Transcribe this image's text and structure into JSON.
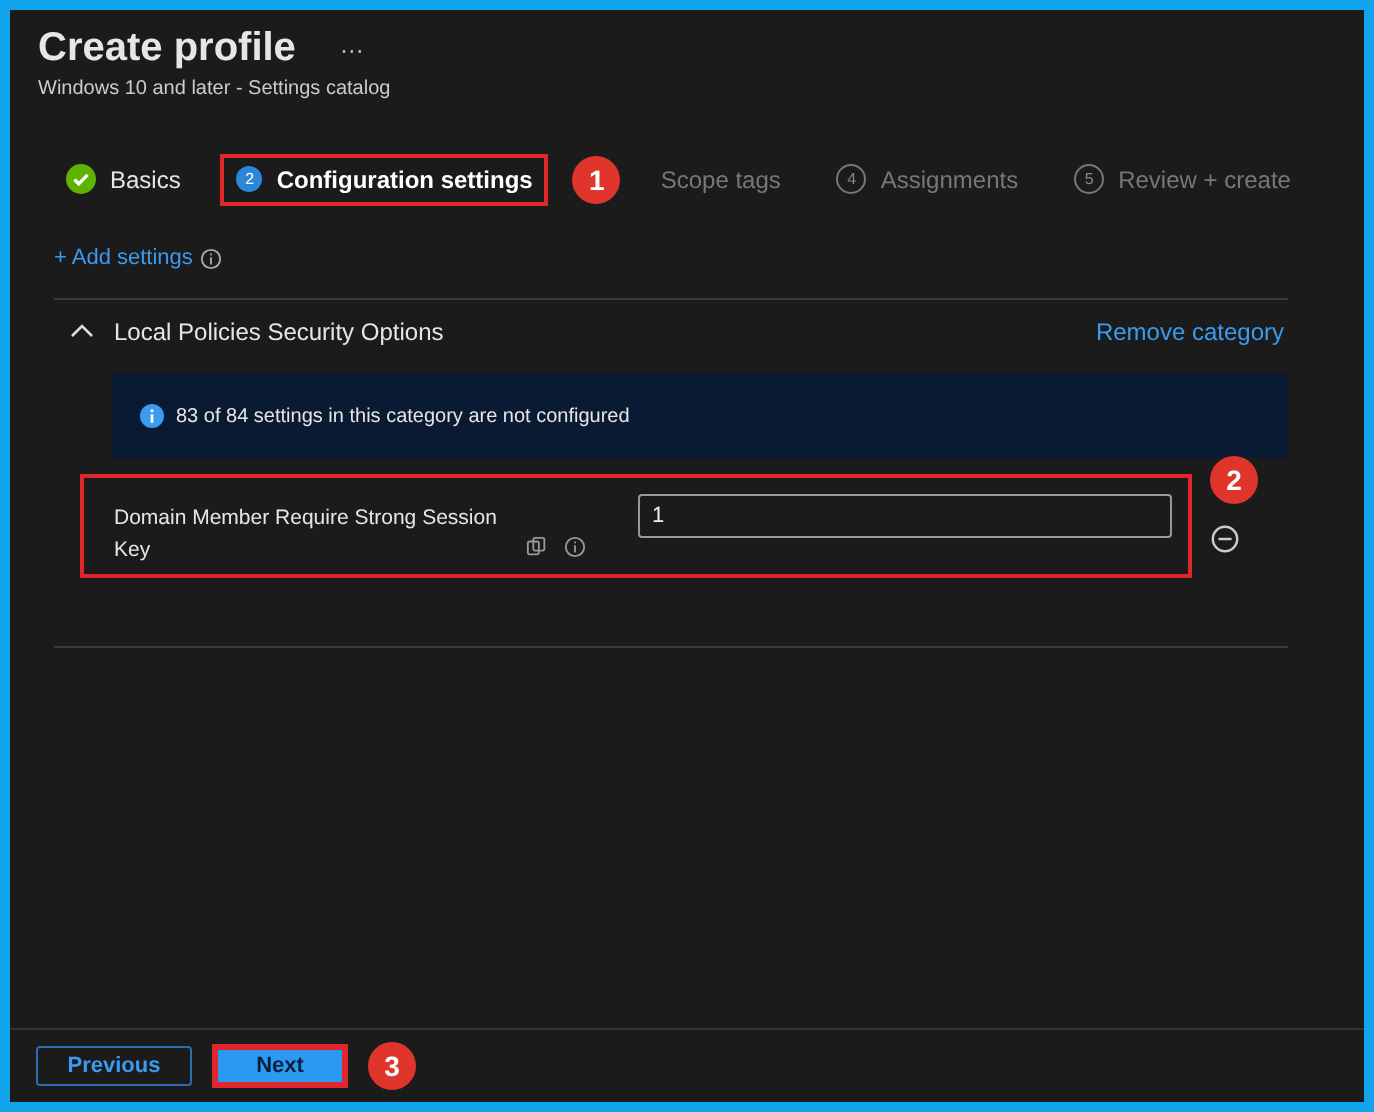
{
  "header": {
    "title": "Create profile",
    "more": "···",
    "subtitle": "Windows 10 and later - Settings catalog"
  },
  "steps": [
    {
      "kind": "done",
      "label": "Basics",
      "selected": false,
      "highlighted": false
    },
    {
      "kind": "current",
      "number": "2",
      "label": "Configuration settings",
      "selected": true,
      "highlighted": true,
      "callout": "1"
    },
    {
      "kind": "pending",
      "label": "Scope tags",
      "selected": false,
      "highlighted": false
    },
    {
      "kind": "pending",
      "number": "4",
      "label": "Assignments",
      "selected": false,
      "highlighted": false
    },
    {
      "kind": "pending",
      "number": "5",
      "label": "Review + create",
      "selected": false,
      "highlighted": false
    }
  ],
  "add_settings": "+ Add settings",
  "category": {
    "title": "Local Policies Security Options",
    "expanded": true,
    "remove": "Remove category",
    "info": "83 of 84 settings in this category are not configured",
    "settings": [
      {
        "label": "Domain Member Require Strong Session Key",
        "value": "1",
        "highlighted": true,
        "callout": "2"
      }
    ]
  },
  "footer": {
    "previous": "Previous",
    "next": "Next",
    "next_highlighted": true,
    "next_callout": "3"
  }
}
